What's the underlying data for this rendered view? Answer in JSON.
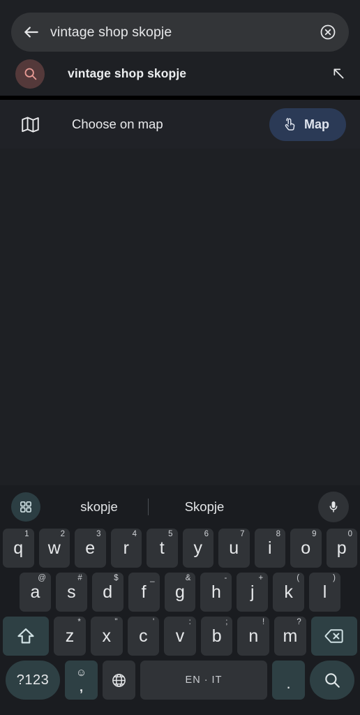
{
  "search": {
    "query": "vintage shop skopje",
    "back_icon": "arrow-left-icon",
    "clear_icon": "clear-circle-icon"
  },
  "suggestion": {
    "label": "vintage shop skopje",
    "leading_icon": "search-icon",
    "trailing_icon": "arrow-northwest-icon",
    "avatar_color": "#54393a"
  },
  "map_row": {
    "icon": "map-fold-icon",
    "label": "Choose on map",
    "button": {
      "label": "Map",
      "icon": "tap-gesture-icon",
      "color": "#2b3a56"
    }
  },
  "keyboard": {
    "toolbar": {
      "grid_icon": "grid-apps-icon",
      "mic_icon": "microphone-icon",
      "suggestions": [
        "skopje",
        "Skopje"
      ]
    },
    "row1": [
      {
        "key": "q",
        "sup": "1"
      },
      {
        "key": "w",
        "sup": "2"
      },
      {
        "key": "e",
        "sup": "3"
      },
      {
        "key": "r",
        "sup": "4"
      },
      {
        "key": "t",
        "sup": "5"
      },
      {
        "key": "y",
        "sup": "6"
      },
      {
        "key": "u",
        "sup": "7"
      },
      {
        "key": "i",
        "sup": "8"
      },
      {
        "key": "o",
        "sup": "9"
      },
      {
        "key": "p",
        "sup": "0"
      }
    ],
    "row2": [
      {
        "key": "a",
        "sup": "@"
      },
      {
        "key": "s",
        "sup": "#"
      },
      {
        "key": "d",
        "sup": "$"
      },
      {
        "key": "f",
        "sup": "_"
      },
      {
        "key": "g",
        "sup": "&"
      },
      {
        "key": "h",
        "sup": "-"
      },
      {
        "key": "j",
        "sup": "+"
      },
      {
        "key": "k",
        "sup": "("
      },
      {
        "key": "l",
        "sup": ")"
      }
    ],
    "row3": [
      {
        "key": "z",
        "sup": "*"
      },
      {
        "key": "x",
        "sup": "\""
      },
      {
        "key": "c",
        "sup": "'"
      },
      {
        "key": "v",
        "sup": ":"
      },
      {
        "key": "b",
        "sup": ";"
      },
      {
        "key": "n",
        "sup": "!"
      },
      {
        "key": "m",
        "sup": "?"
      }
    ],
    "shift_icon": "shift-arrow-icon",
    "backspace_icon": "backspace-icon",
    "row4": {
      "numeric_label": "?123",
      "emoji_icon": "emoji-smiley-icon",
      "comma_label": ",",
      "globe_icon": "language-globe-icon",
      "space_label": "EN · IT",
      "period_label": ".",
      "search_icon": "search-icon"
    }
  }
}
